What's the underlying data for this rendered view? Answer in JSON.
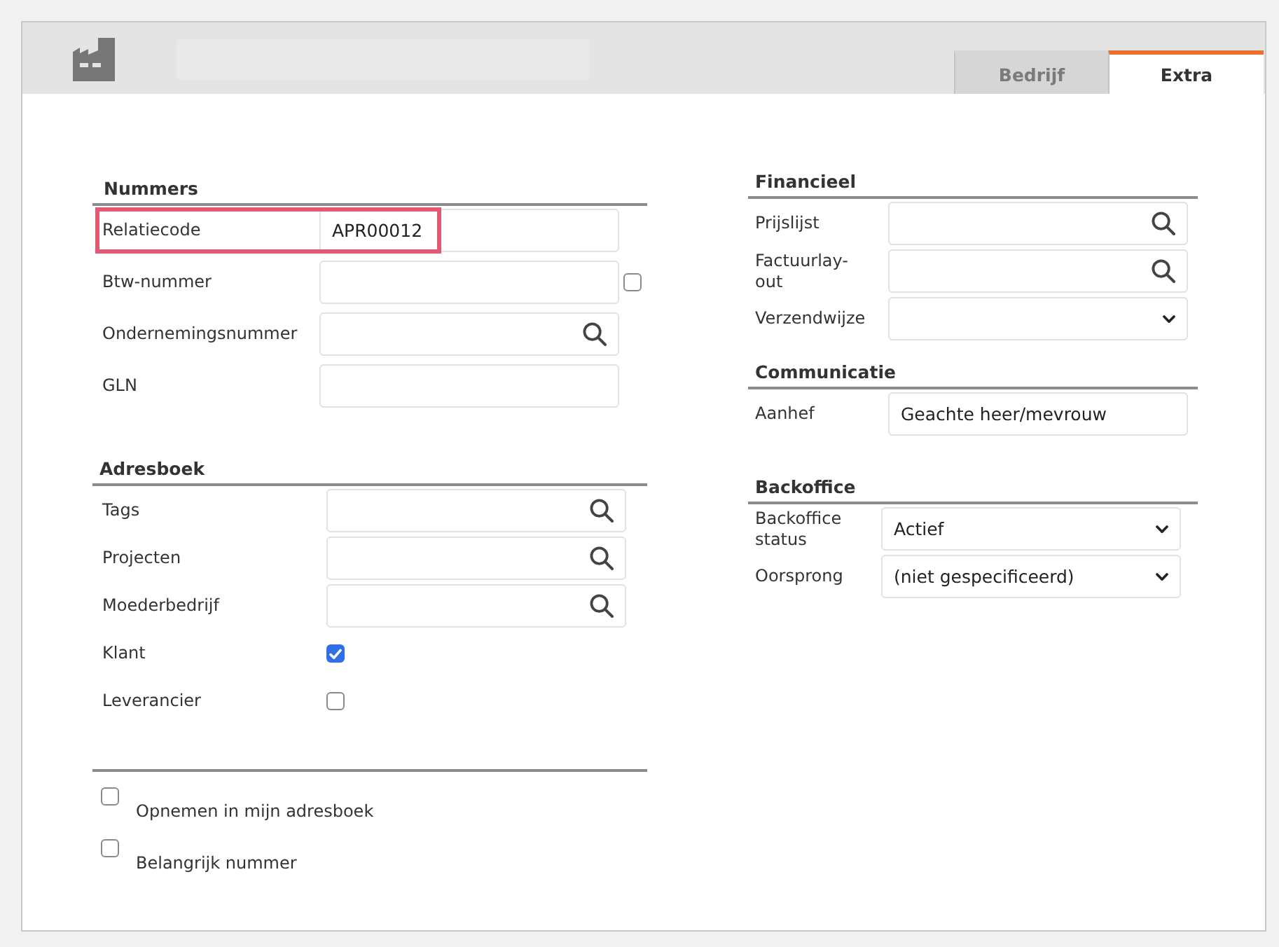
{
  "tabs": [
    {
      "label": "Bedrijf",
      "selected": false
    },
    {
      "label": "Extra",
      "selected": true
    }
  ],
  "left_panel": {
    "sections": [
      {
        "title": "Nummers",
        "fields": [
          {
            "kind": "text",
            "label": "Relatiecode",
            "value": "APR00012",
            "highlighted": true
          },
          {
            "kind": "text",
            "label": "Btw-nummer",
            "highlighted": false,
            "side_checkbox": {
              "checked": false
            }
          },
          {
            "kind": "search",
            "label": "Ondernemingsnummer",
            "highlighted": false
          },
          {
            "kind": "text",
            "label": "GLN",
            "highlighted": false
          }
        ]
      },
      {
        "title": "Adresboek",
        "fields": [
          {
            "kind": "search",
            "label": "Tags",
            "highlighted": false
          },
          {
            "kind": "search",
            "label": "Projecten",
            "highlighted": false
          },
          {
            "kind": "search",
            "label": "Moederbedrijf",
            "highlighted": false
          },
          {
            "kind": "checkbox",
            "label": "Klant",
            "checked": true,
            "highlighted": false
          },
          {
            "kind": "checkbox",
            "label": "Leverancier",
            "checked": false,
            "highlighted": false
          }
        ]
      }
    ],
    "options": [
      {
        "label": "Opnemen in mijn adresboek",
        "checked": false
      },
      {
        "label": "Belangrijk nummer",
        "checked": false
      }
    ]
  },
  "right_panel": {
    "sections": [
      {
        "title": "Financieel",
        "fields": [
          {
            "kind": "search",
            "label": "Prijslijst",
            "highlighted": false
          },
          {
            "kind": "search",
            "label": "Factuurlay-out",
            "highlighted": false
          },
          {
            "kind": "select",
            "label": "Verzendwijze",
            "highlighted": false
          }
        ]
      },
      {
        "title": "Communicatie",
        "fields": [
          {
            "kind": "text",
            "label": "Aanhef",
            "value": "Geachte heer/mevrouw",
            "highlighted": false
          }
        ]
      },
      {
        "title": "Backoffice",
        "fields": [
          {
            "kind": "select",
            "label": "Backoffice status",
            "value": "Actief",
            "highlighted": false
          },
          {
            "kind": "select",
            "label": "Oorsprong",
            "value": "(niet gespecificeerd)",
            "highlighted": false
          }
        ]
      }
    ]
  }
}
